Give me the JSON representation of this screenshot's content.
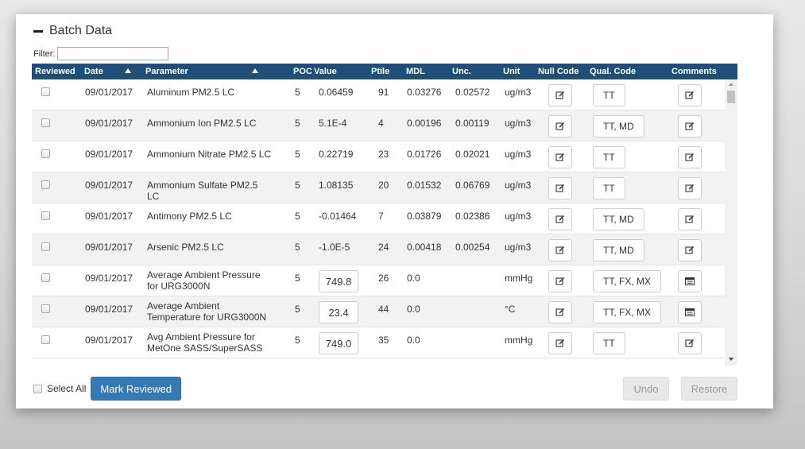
{
  "section": {
    "title": "Batch Data"
  },
  "filter": {
    "label": "Filter:",
    "value": "",
    "placeholder": ""
  },
  "columns": {
    "reviewed": "Reviewed",
    "date": "Date",
    "parameter": "Parameter",
    "poc": "POC",
    "value": "Value",
    "ptile": "Ptile",
    "mdl": "MDL",
    "unc": "Unc.",
    "unit": "Unit",
    "null_code": "Null Code",
    "qual_code": "Qual. Code",
    "comments": "Comments"
  },
  "rows": [
    {
      "date": "09/01/2017",
      "parameter": "Aluminum PM2.5 LC",
      "poc": "5",
      "value": "0.06459",
      "ptile": "91",
      "mdl": "0.03276",
      "unc": "0.02572",
      "unit": "ug/m3",
      "qual": "TT",
      "value_editable": false,
      "comment_icon": "edit-icon"
    },
    {
      "date": "09/01/2017",
      "parameter": "Ammonium Ion PM2.5 LC",
      "poc": "5",
      "value": "5.1E-4",
      "ptile": "4",
      "mdl": "0.00196",
      "unc": "0.00119",
      "unit": "ug/m3",
      "qual": "TT, MD",
      "value_editable": false,
      "comment_icon": "edit-icon"
    },
    {
      "date": "09/01/2017",
      "parameter": "Ammonium Nitrate PM2.5 LC",
      "poc": "5",
      "value": "0.22719",
      "ptile": "23",
      "mdl": "0.01726",
      "unc": "0.02021",
      "unit": "ug/m3",
      "qual": "TT",
      "value_editable": false,
      "comment_icon": "edit-icon"
    },
    {
      "date": "09/01/2017",
      "parameter": "Ammonium Sulfate PM2.5 LC",
      "poc": "5",
      "value": "1.08135",
      "ptile": "20",
      "mdl": "0.01532",
      "unc": "0.06769",
      "unit": "ug/m3",
      "qual": "TT",
      "value_editable": false,
      "comment_icon": "edit-icon"
    },
    {
      "date": "09/01/2017",
      "parameter": "Antimony PM2.5 LC",
      "poc": "5",
      "value": "-0.01464",
      "ptile": "7",
      "mdl": "0.03879",
      "unc": "0.02386",
      "unit": "ug/m3",
      "qual": "TT, MD",
      "value_editable": false,
      "comment_icon": "edit-icon"
    },
    {
      "date": "09/01/2017",
      "parameter": "Arsenic PM2.5 LC",
      "poc": "5",
      "value": "-1.0E-5",
      "ptile": "24",
      "mdl": "0.00418",
      "unc": "0.00254",
      "unit": "ug/m3",
      "qual": "TT, MD",
      "value_editable": false,
      "comment_icon": "edit-icon"
    },
    {
      "date": "09/01/2017",
      "parameter": "Average Ambient Pressure for URG3000N",
      "poc": "5",
      "value": "749.8",
      "ptile": "26",
      "mdl": "0.0",
      "unc": "",
      "unit": "mmHg",
      "qual": "TT, FX, MX",
      "value_editable": true,
      "comment_icon": "comment-list-icon"
    },
    {
      "date": "09/01/2017",
      "parameter": "Average Ambient Temperature for URG3000N",
      "poc": "5",
      "value": "23.4",
      "ptile": "44",
      "mdl": "0.0",
      "unc": "",
      "unit": "°C",
      "qual": "TT, FX, MX",
      "value_editable": true,
      "comment_icon": "comment-list-icon"
    },
    {
      "date": "09/01/2017",
      "parameter": "Avg Ambient Pressure for MetOne SASS/SuperSASS",
      "poc": "5",
      "value": "749.0",
      "ptile": "35",
      "mdl": "0.0",
      "unc": "",
      "unit": "mmHg",
      "qual": "TT",
      "value_editable": true,
      "comment_icon": "edit-icon"
    }
  ],
  "footer": {
    "select_all": "Select All",
    "mark_reviewed": "Mark Reviewed",
    "undo": "Undo",
    "restore": "Restore"
  },
  "colors": {
    "header_bg": "#1f4e79",
    "primary": "#337ab7"
  }
}
